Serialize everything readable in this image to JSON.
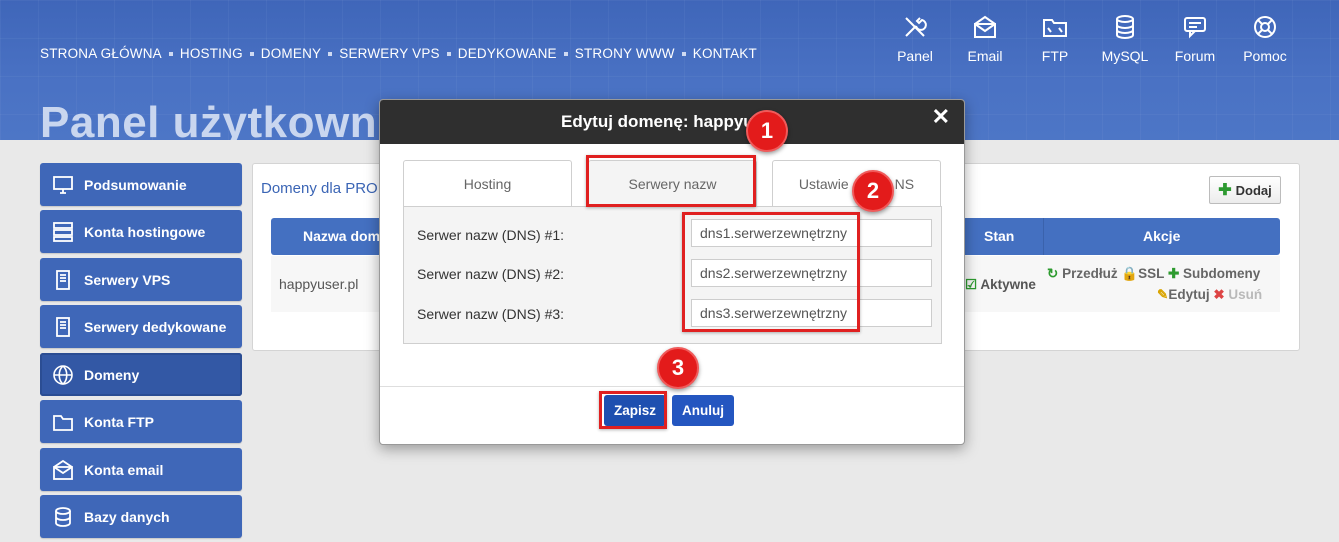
{
  "nav": {
    "items": [
      "STRONA GŁÓWNA",
      "HOSTING",
      "DOMENY",
      "SERWERY VPS",
      "DEDYKOWANE",
      "STRONY WWW",
      "KONTAKT"
    ]
  },
  "quick_links": [
    {
      "label": "Panel",
      "icon": "tools-icon"
    },
    {
      "label": "Email",
      "icon": "mail-icon"
    },
    {
      "label": "FTP",
      "icon": "folder-icon"
    },
    {
      "label": "MySQL",
      "icon": "database-icon"
    },
    {
      "label": "Forum",
      "icon": "chat-icon"
    },
    {
      "label": "Pomoc",
      "icon": "lifebuoy-icon"
    }
  ],
  "page_title": "Panel użytkowni",
  "sidebar": {
    "items": [
      {
        "label": "Podsumowanie",
        "icon": "monitor-icon"
      },
      {
        "label": "Konta hostingowe",
        "icon": "server-icon"
      },
      {
        "label": "Serwery VPS",
        "icon": "vps-icon"
      },
      {
        "label": "Serwery dedykowane",
        "icon": "dedicated-server-icon"
      },
      {
        "label": "Domeny",
        "icon": "globe-icon",
        "active": true
      },
      {
        "label": "Konta FTP",
        "icon": "ftp-folder-icon"
      },
      {
        "label": "Konta email",
        "icon": "email-icon"
      },
      {
        "label": "Bazy danych",
        "icon": "database-icon"
      }
    ]
  },
  "main": {
    "heading": "Domeny dla PRO",
    "add_label": "Dodaj",
    "columns": {
      "name": "Nazwa dom",
      "status": "Stan",
      "actions": "Akcje"
    },
    "row": {
      "domain": "happyuser.pl",
      "status": "Aktywne",
      "actions": {
        "renew": "Przedłuż",
        "ssl": "SSL",
        "subdomains": "Subdomeny",
        "edit": "Edytuj",
        "delete": "Usuń"
      }
    }
  },
  "modal": {
    "title": "Edytuj domenę: happyuser.",
    "close": "✕",
    "tabs": [
      "Hosting",
      "Serwery nazw",
      "Ustawie",
      "NS"
    ],
    "active_tab": "Serwery nazw",
    "fields": [
      {
        "label": "Serwer nazw (DNS) #1:",
        "value": "dns1.serwerzewnętrzny"
      },
      {
        "label": "Serwer nazw (DNS) #2:",
        "value": "dns2.serwerzewnętrzny"
      },
      {
        "label": "Serwer nazw (DNS) #3:",
        "value": "dns3.serwerzewnętrzny"
      }
    ],
    "save_label": "Zapisz",
    "cancel_label": "Anuluj"
  },
  "annotations": {
    "steps": [
      "1",
      "2",
      "3"
    ],
    "highlight_color": "#e02020"
  },
  "colors": {
    "brand_blue": "#3f67b8",
    "header_blue": "#4a72c4",
    "modal_header": "#2f2f2f",
    "success": "#2d9b2f"
  }
}
